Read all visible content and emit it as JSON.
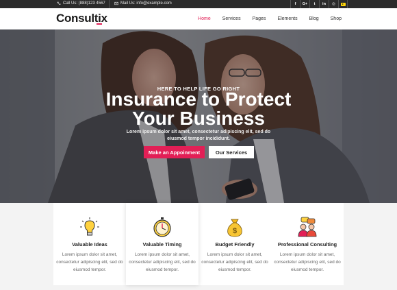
{
  "topbar": {
    "phone": "Call Us: (888)123 4567",
    "email": "Mail Us: info@example.com",
    "socials": [
      {
        "icon": "facebook-icon",
        "glyph": "f"
      },
      {
        "icon": "google-plus-icon",
        "glyph": "G+"
      },
      {
        "icon": "twitter-icon",
        "glyph": "t"
      },
      {
        "icon": "linkedin-icon",
        "glyph": "in"
      },
      {
        "icon": "instagram-icon",
        "glyph": "◎"
      },
      {
        "icon": "youtube-icon",
        "glyph": ""
      }
    ]
  },
  "brand": {
    "name": "Consultix",
    "accent": "#e21f56"
  },
  "nav": {
    "items": [
      "Home",
      "Services",
      "Pages",
      "Elements",
      "Blog",
      "Shop"
    ],
    "active": "Home"
  },
  "hero": {
    "kicker": "HERE TO HELP LIFE GO RIGHT",
    "headline_line1": "Insurance to Protect",
    "headline_line2": "Your Business",
    "subtext": "Lorem ipsum dolor sit amet, consectetur adipiscing elit, sed do eiusmod tempor incididunt.",
    "primary_button": "Make an Appoinment",
    "secondary_button": "Our Services"
  },
  "features": [
    {
      "icon": "lightbulb-icon",
      "title": "Valuable Ideas",
      "desc": "Lorem ipsum dolor sit amet, consectetur adipiscing elit, sed do eiusmod tempor."
    },
    {
      "icon": "stopwatch-icon",
      "title": "Valuable Timing",
      "desc": "Lorem ipsum dolor sit amet, consectetur adipiscing elit, sed do eiusmod tempor."
    },
    {
      "icon": "money-bag-icon",
      "title": "Budget Friendly",
      "desc": "Lorem ipsum dolor sit amet, consectetur adipiscing elit, sed do eiusmod tempor."
    },
    {
      "icon": "consulting-people-icon",
      "title": "Professional Consulting",
      "desc": "Lorem ipsum dolor sit amet, consectetur adipiscing elit, sed do eiusmod tempor."
    }
  ]
}
